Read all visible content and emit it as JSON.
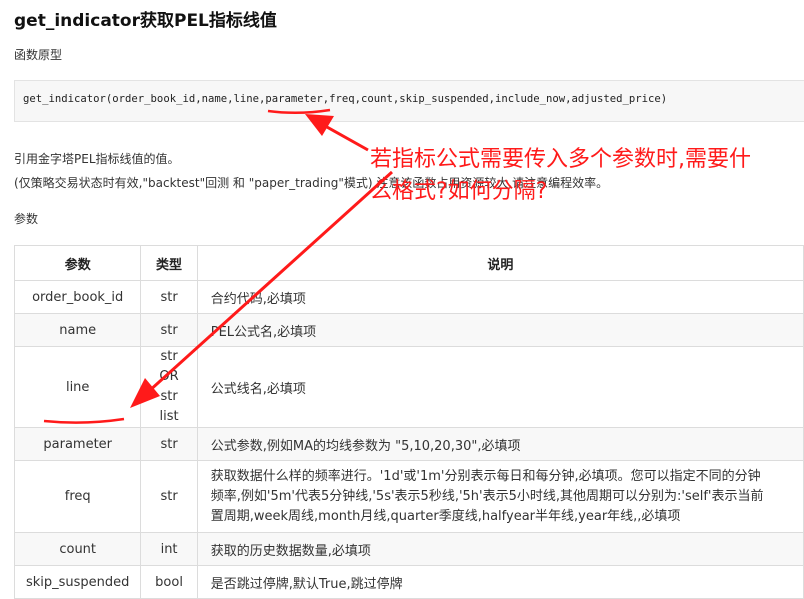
{
  "page": {
    "title": "get_indicator获取PEL指标线值",
    "prototype_label": "函数原型",
    "code": "get_indicator(order_book_id,name,line,parameter,freq,count,skip_suspended,include_now,adjusted_price)",
    "description_1": "引用金字塔PEL指标线值的值。",
    "description_2": "(仅策略交易状态时有效,\"backtest\"回测 和 \"paper_trading\"模式) 注意该函数占用资源较大,请注意编程效率。",
    "params_label": "参数"
  },
  "table": {
    "headers": {
      "param": "参数",
      "type": "类型",
      "desc": "说明"
    },
    "rows": [
      {
        "param": "order_book_id",
        "type": "str",
        "desc": "合约代码,必填项"
      },
      {
        "param": "name",
        "type": "str",
        "desc": "PEL公式名,必填项"
      },
      {
        "param": "line",
        "type_1": "str OR",
        "type_2": "str list",
        "desc": "公式线名,必填项"
      },
      {
        "param": "parameter",
        "type": "str",
        "desc": "公式参数,例如MA的均线参数为 \"5,10,20,30\",必填项"
      },
      {
        "param": "freq",
        "type": "str",
        "desc_1": "获取数据什么样的频率进行。'1d'或'1m'分别表示每日和每分钟,必填项。您可以指定不同的分钟",
        "desc_2": "频率,例如'5m'代表5分钟线,'5s'表示5秒线,'5h'表示5小时线,其他周期可以分别为:'self'表示当前",
        "desc_3": "置周期,week周线,month月线,quarter季度线,halfyear半年线,year年线,,必填项"
      },
      {
        "param": "count",
        "type": "int",
        "desc": "获取的历史数据数量,必填项"
      },
      {
        "param": "skip_suspended",
        "type": "bool",
        "desc": "是否跳过停牌,默认True,跳过停牌"
      }
    ]
  },
  "annotation": {
    "line_1": "若指标公式需要传入多个参数时,需要什",
    "line_2": "么格式?如何分隔?",
    "color": "#ff1a1a"
  }
}
